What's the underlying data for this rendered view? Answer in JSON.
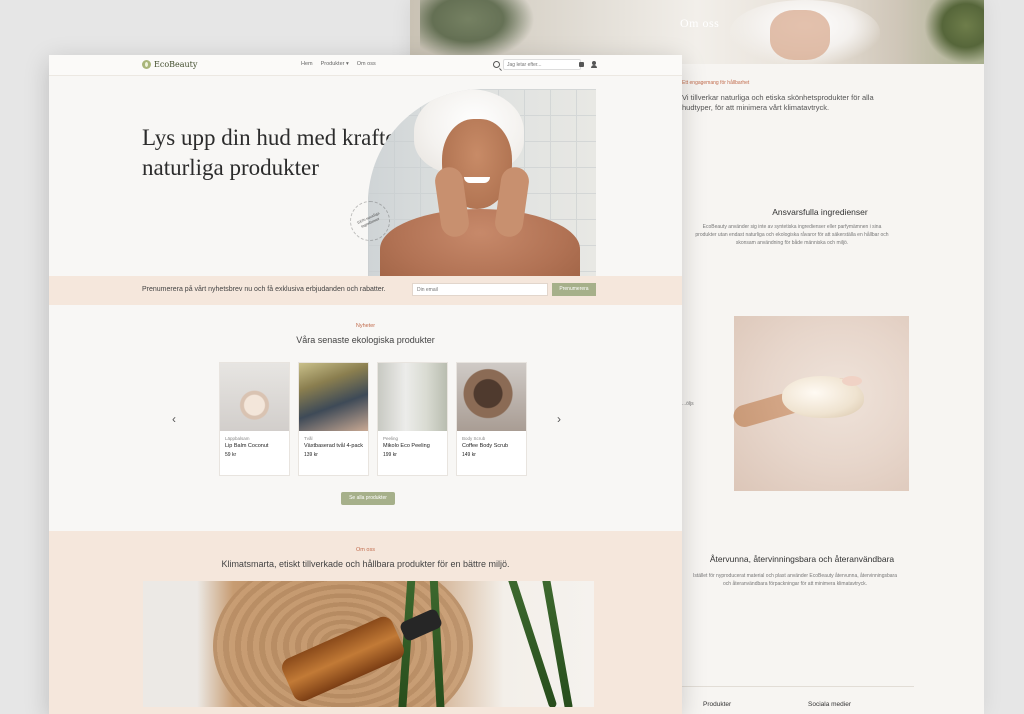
{
  "back_page": {
    "hero_title": "Om oss",
    "eyebrow": "Ett engagemang för hållbarhet",
    "intro": "Vi tillverkar naturliga och etiska skönhetsprodukter för alla hudtyper, för att minimera vårt klimatavtryck.",
    "section1_title": "Ansvarsfulla ingredienser",
    "section1_text": "EcoBeauty använder sig inte av syntetiska ingredienser eller parfymämnen i sina produkter utan endast naturliga och ekologiska råvaror för att säkerställa en hållbar och skonsam användning för både människa och miljö.",
    "aside_text": "...öljs",
    "section2_title": "Återvunna, återvinningsbara och återanvändbara",
    "section2_text": "Istället för nyproducerat material och plast använder EcoBeauty återvunna, återvinningsbara och återanvändbara förpackningar för att minimera klimatavtryck.",
    "footer_col1": "Produkter",
    "footer_col2": "Sociala medier"
  },
  "nav": {
    "logo": "EcoBeauty",
    "links": [
      "Hem",
      "Produkter ▾",
      "Om oss"
    ],
    "search_placeholder": "Jag letar efter..."
  },
  "hero": {
    "title": "Lys upp din hud med kraften i naturliga produkter",
    "badge": "100% naturliga ingredienser"
  },
  "newsletter": {
    "text": "Prenumerera på vårt nyhetsbrev nu och få exklusiva erbjudanden och rabatter.",
    "placeholder": "Din email",
    "button": "Prenumerera"
  },
  "news": {
    "eyebrow": "Nyheter",
    "title": "Våra senaste ekologiska produkter",
    "products": [
      {
        "category": "Läppbalsam",
        "name": "Lip Balm Coconut",
        "price": "59 kr"
      },
      {
        "category": "Tvål",
        "name": "Växtbaserad tvål 4-pack",
        "price": "139 kr"
      },
      {
        "category": "Peeling",
        "name": "Mikolo Eco Peeling",
        "price": "199 kr"
      },
      {
        "category": "Body Scrub",
        "name": "Coffee Body Scrub",
        "price": "149 kr"
      }
    ],
    "prev": "‹",
    "next": "›",
    "see_all": "Se alla produkter"
  },
  "about": {
    "eyebrow": "Om oss",
    "title": "Klimatsmarta, etiskt tillverkade och hållbara produkter för en bättre miljö."
  }
}
